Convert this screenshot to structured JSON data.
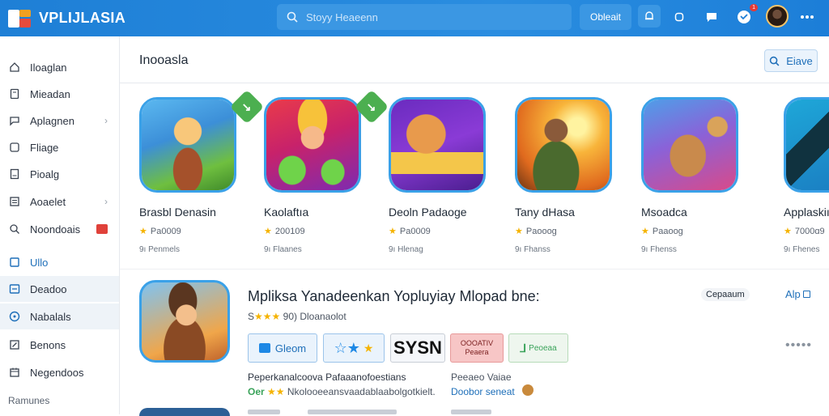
{
  "app": {
    "title": "VPLIJLASIA"
  },
  "search": {
    "placeholder": "Stoyy Heaeenn"
  },
  "topbar": {
    "action_label": "Obleait",
    "notification_count": "1"
  },
  "sidebar": {
    "items": [
      {
        "label": "Iloaglan",
        "icon": "home-icon"
      },
      {
        "label": "Mieadan",
        "icon": "document-icon"
      },
      {
        "label": "Aplagnen",
        "icon": "chat-icon",
        "chevron": true
      },
      {
        "label": "Fliage",
        "icon": "square-icon"
      },
      {
        "label": "Pioalg",
        "icon": "file-icon"
      },
      {
        "label": "Aoaelet",
        "icon": "list-icon",
        "chevron": true
      },
      {
        "label": "Noondoais",
        "icon": "search-icon",
        "badge": true
      },
      {
        "label": "Ullo",
        "icon": "window-icon",
        "highlight": true
      },
      {
        "label": "Deadoo",
        "icon": "menu-icon",
        "active": true
      },
      {
        "label": "Nabalals",
        "icon": "circle-icon",
        "active": true
      },
      {
        "label": "Benons",
        "icon": "edit-icon"
      },
      {
        "label": "Negendoos",
        "icon": "calendar-icon"
      }
    ],
    "footer": "Ramunes"
  },
  "main": {
    "title": "Inooasla",
    "header_button": "Eiave"
  },
  "cards": [
    {
      "title": "Brasbl Denasin",
      "rating": "Pa0009",
      "dev": "9ı Penmels",
      "install": true
    },
    {
      "title": "Kaolaftıa",
      "rating": "200109",
      "dev": "9ı Flaanes",
      "install": true
    },
    {
      "title": "Deoln Padaoge",
      "rating": "Pa0009",
      "dev": "9ı Hlenag",
      "install": false
    },
    {
      "title": "Tany dHasa",
      "rating": "Paooog",
      "dev": "9ı Fhanss",
      "install": false
    },
    {
      "title": "Msoadca",
      "rating": "Paaoog",
      "dev": "9ı Fhenss",
      "install": false
    },
    {
      "title": "Applaskiı",
      "rating": "7000ɑ9",
      "dev": "9ı Fhenes",
      "install": false
    }
  ],
  "featured": {
    "title": "Mpliksa Yanadeenkan Yopluyiay Mlopad bne:",
    "tag": "Cepaaum",
    "link": "Alp",
    "rating_prefix": "S",
    "rating_text": "90) Dloanaolot",
    "chips": [
      {
        "label": "Gleom",
        "style": "blue"
      },
      {
        "label": "",
        "style": "stars"
      },
      {
        "label": "SYSN",
        "style": "dark"
      },
      {
        "label": "OOOATIV Peaera",
        "style": "red"
      },
      {
        "label": "Peoeaa",
        "style": "green"
      }
    ],
    "desc1": "Peperkanalcoova Pafaaanofoestians",
    "desc2_prefix": "Oer",
    "desc2_text": "Nkolooeeansvaadablaabolgotkielt.",
    "price1": "Peeaeo Vaiae",
    "price2": "Doobor seneat"
  },
  "colors": {
    "topbar": "#1e7fd6",
    "accent": "#1e6fb9",
    "install_green": "#4caf50",
    "star": "#f5b301"
  }
}
